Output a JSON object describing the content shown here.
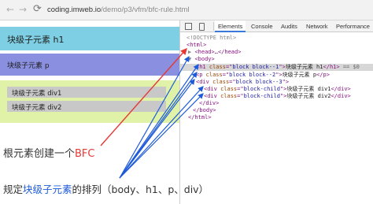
{
  "browser": {
    "url_host": "coding.imweb.io",
    "url_path": "/demo/p3/vfm/bfc-rule.html"
  },
  "page": {
    "block1_text": "块级子元素 h1",
    "block2_text": "块级子元素 p",
    "div1_text": "块级子元素 div1",
    "div2_text": "块级子元素 div2"
  },
  "devtools": {
    "tabs": [
      "Elements",
      "Console",
      "Audits",
      "Network",
      "Performance"
    ],
    "active_tab": "Elements",
    "dom": {
      "doctype": "<!DOCTYPE html>",
      "html_open": "<html>",
      "head": "<head>…</head>",
      "body_open": "<body>",
      "h1_tag": "h1",
      "h1_class": "block block--1",
      "h1_text": "块级子元素 h1",
      "h1_eq": "== $0",
      "p_tag": "p",
      "p_class": "block block--2",
      "p_text": "块级子元素 p",
      "div3_tag": "div",
      "div3_class": "block block--3",
      "child1_class": "block-child",
      "child1_text": "块级子元素 div1",
      "child2_class": "block-child",
      "child2_text": "块级子元素 div2",
      "div_close": "</div>",
      "body_close": "</body>",
      "html_close": "</html>"
    }
  },
  "annotations": {
    "line1_prefix": "根元素创建一个",
    "line1_bfc": "BFC",
    "line2_prefix": "规定",
    "line2_highlight": "块级子元素",
    "line2_suffix": "的排列（body、h1、p、div）"
  },
  "colors": {
    "red_arrow": "#e53935",
    "blue_arrow": "#1e5bd8",
    "block1": "#7ecfe3",
    "block2": "#8a8fe0",
    "block3": "#dff2a8",
    "child": "#c8c8c8"
  }
}
